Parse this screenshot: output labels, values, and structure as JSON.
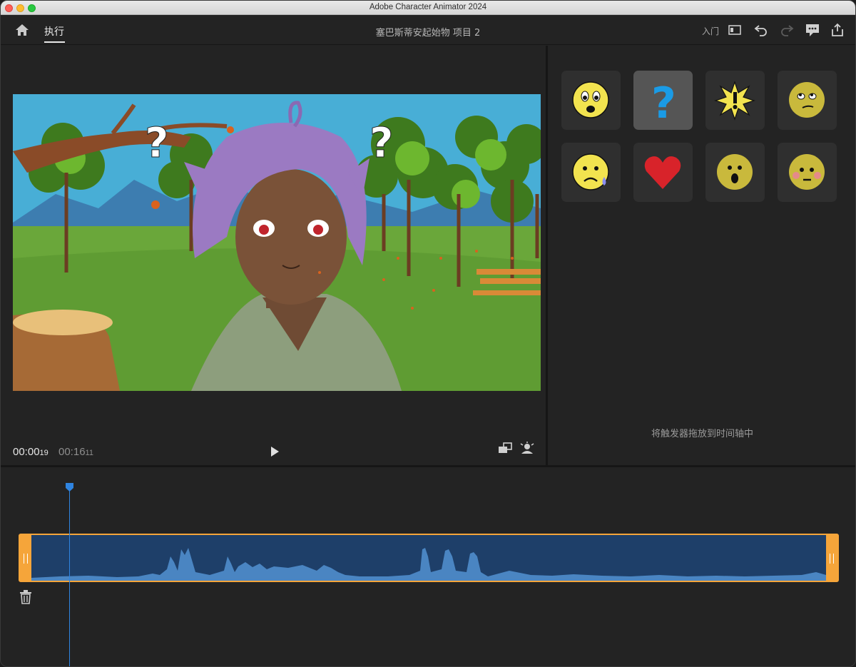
{
  "window": {
    "title": "Adobe Character Animator 2024"
  },
  "appbar": {
    "mode_tab": "执行",
    "project_title": "塞巴斯蒂安起始物 项目 2",
    "learn_label": "入门",
    "icons": [
      "home-icon",
      "panel-layout-icon",
      "undo-icon",
      "redo-icon",
      "feedback-icon",
      "share-icon"
    ]
  },
  "stage": {
    "current_time": "00:00",
    "current_frames": "19",
    "duration_time": "00:16",
    "duration_frames": "11"
  },
  "triggers": {
    "items": [
      {
        "name": "worried-face",
        "selected": false
      },
      {
        "name": "question-mark",
        "selected": true
      },
      {
        "name": "exclamation-burst",
        "selected": false
      },
      {
        "name": "eye-roll-face",
        "selected": false
      },
      {
        "name": "sad-sweat-face",
        "selected": false
      },
      {
        "name": "heart",
        "selected": false
      },
      {
        "name": "surprised-face",
        "selected": false
      },
      {
        "name": "blushing-face",
        "selected": false
      }
    ],
    "hint": "将触发器拖放到时间轴中"
  },
  "timeline": {
    "playhead_fraction": 0.06,
    "colors": {
      "clip_fill": "#1e3f69",
      "clip_border": "#f5a53a",
      "waveform": "#4a85c2",
      "playhead": "#2f84e0"
    }
  }
}
